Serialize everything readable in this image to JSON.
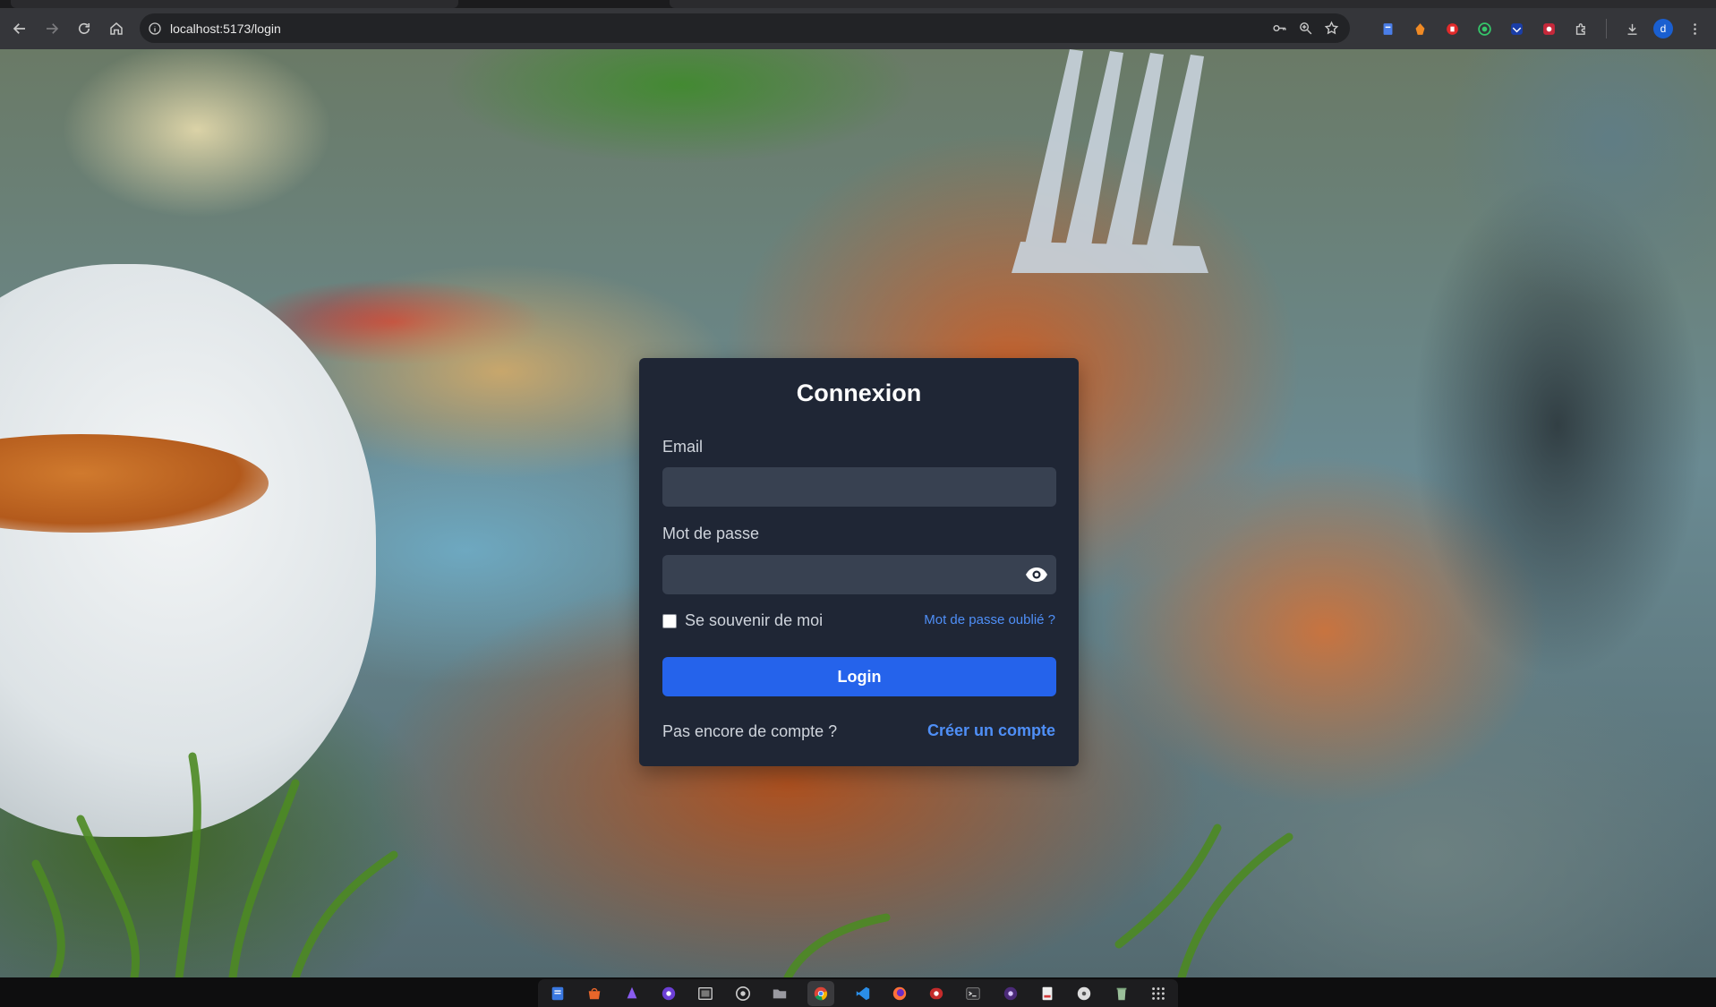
{
  "browser": {
    "url": "localhost:5173/login",
    "profile_initial": "d"
  },
  "login": {
    "title": "Connexion",
    "email_label": "Email",
    "email_value": "",
    "password_label": "Mot de passe",
    "password_value": "",
    "remember_label": "Se souvenir de moi",
    "remember_checked": false,
    "forgot_link": "Mot de passe oublié ?",
    "submit_label": "Login",
    "no_account_text": "Pas encore de compte ?",
    "create_account_link": "Créer un compte"
  },
  "colors": {
    "card_bg": "#1f2635",
    "input_bg": "#384151",
    "primary": "#2563eb",
    "link": "#4f8ff7"
  },
  "taskbar": {
    "apps": [
      "files-doc-icon",
      "app-store-icon",
      "app-purple-icon",
      "app-violet-icon",
      "screenshot-icon",
      "settings-disc-icon",
      "folder-icon",
      "chrome-icon",
      "vscode-icon",
      "firefox-icon",
      "recorder-icon",
      "terminal-icon",
      "media-icon",
      "document-viewer-icon",
      "disc-icon",
      "trash-icon",
      "app-grid-icon"
    ]
  }
}
